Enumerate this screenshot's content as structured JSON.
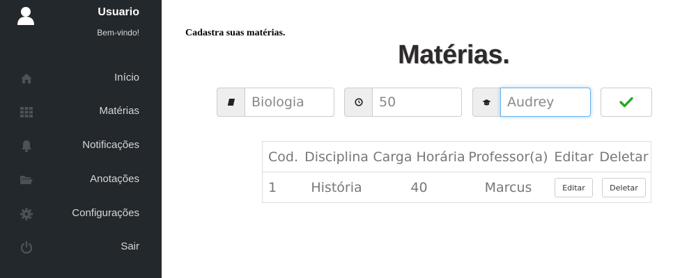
{
  "sidebar": {
    "user": {
      "name": "Usuario",
      "welcome": "Bem-vindo!"
    },
    "items": [
      {
        "label": "Início",
        "icon": "home-icon"
      },
      {
        "label": "Matérias",
        "icon": "grid-icon"
      },
      {
        "label": "Notificações",
        "icon": "bell-icon"
      },
      {
        "label": "Anotações",
        "icon": "folder-open-icon"
      },
      {
        "label": "Configurações",
        "icon": "gear-icon"
      },
      {
        "label": "Sair",
        "icon": "power-icon"
      }
    ]
  },
  "main": {
    "subtitle": "Cadastra suas matérias.",
    "title": "Matérias.",
    "form": {
      "subject": {
        "value": "Biologia",
        "icon": "book-icon"
      },
      "hours": {
        "value": "50",
        "icon": "clock-icon"
      },
      "teacher": {
        "value": "Audrey",
        "icon": "graduation-cap-icon"
      },
      "confirm_icon": "check-icon"
    },
    "table": {
      "headers": [
        "Cod.",
        "Disciplina",
        "Carga Horária",
        "Professor(a)",
        "Editar",
        "Deletar"
      ],
      "rows": [
        {
          "cod": "1",
          "disciplina": "História",
          "carga": "40",
          "professor": "Marcus",
          "edit_label": "Editar",
          "delete_label": "Deletar"
        }
      ]
    }
  },
  "colors": {
    "sidebar_bg": "#23282c",
    "confirm_check": "#22a822",
    "title": "#2d2a2a"
  }
}
